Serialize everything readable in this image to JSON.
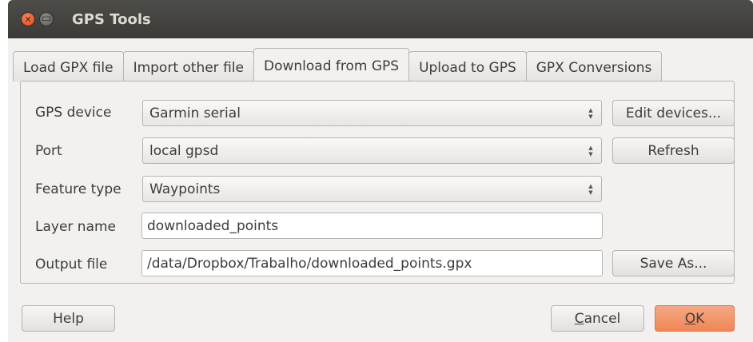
{
  "window": {
    "title": "GPS Tools"
  },
  "tabs": [
    {
      "label": "Load GPX file"
    },
    {
      "label": "Import other file"
    },
    {
      "label": "Download from GPS"
    },
    {
      "label": "Upload to GPS"
    },
    {
      "label": "GPX Conversions"
    }
  ],
  "active_tab": "Download from GPS",
  "form": {
    "gps_device_label": "GPS device",
    "gps_device_value": "Garmin serial",
    "port_label": "Port",
    "port_value": "local gpsd",
    "feature_type_label": "Feature type",
    "feature_type_value": "Waypoints",
    "layer_name_label": "Layer name",
    "layer_name_value": "downloaded_points",
    "output_file_label": "Output file",
    "output_file_value": "/data/Dropbox/Trabalho/downloaded_points.gpx"
  },
  "buttons": {
    "edit_devices": "Edit devices...",
    "refresh": "Refresh",
    "save_as": "Save As...",
    "help": "Help",
    "cancel_first": "C",
    "cancel_rest": "ancel",
    "ok_first": "O",
    "ok_rest": "K"
  },
  "colors": {
    "ok_accent": "#f08656",
    "titlebar": "#3b3a36",
    "close_button": "#e0491b"
  },
  "icons": {
    "close": "close-icon",
    "minimize": "minimize-icon",
    "spin": "updown-arrows-icon"
  }
}
